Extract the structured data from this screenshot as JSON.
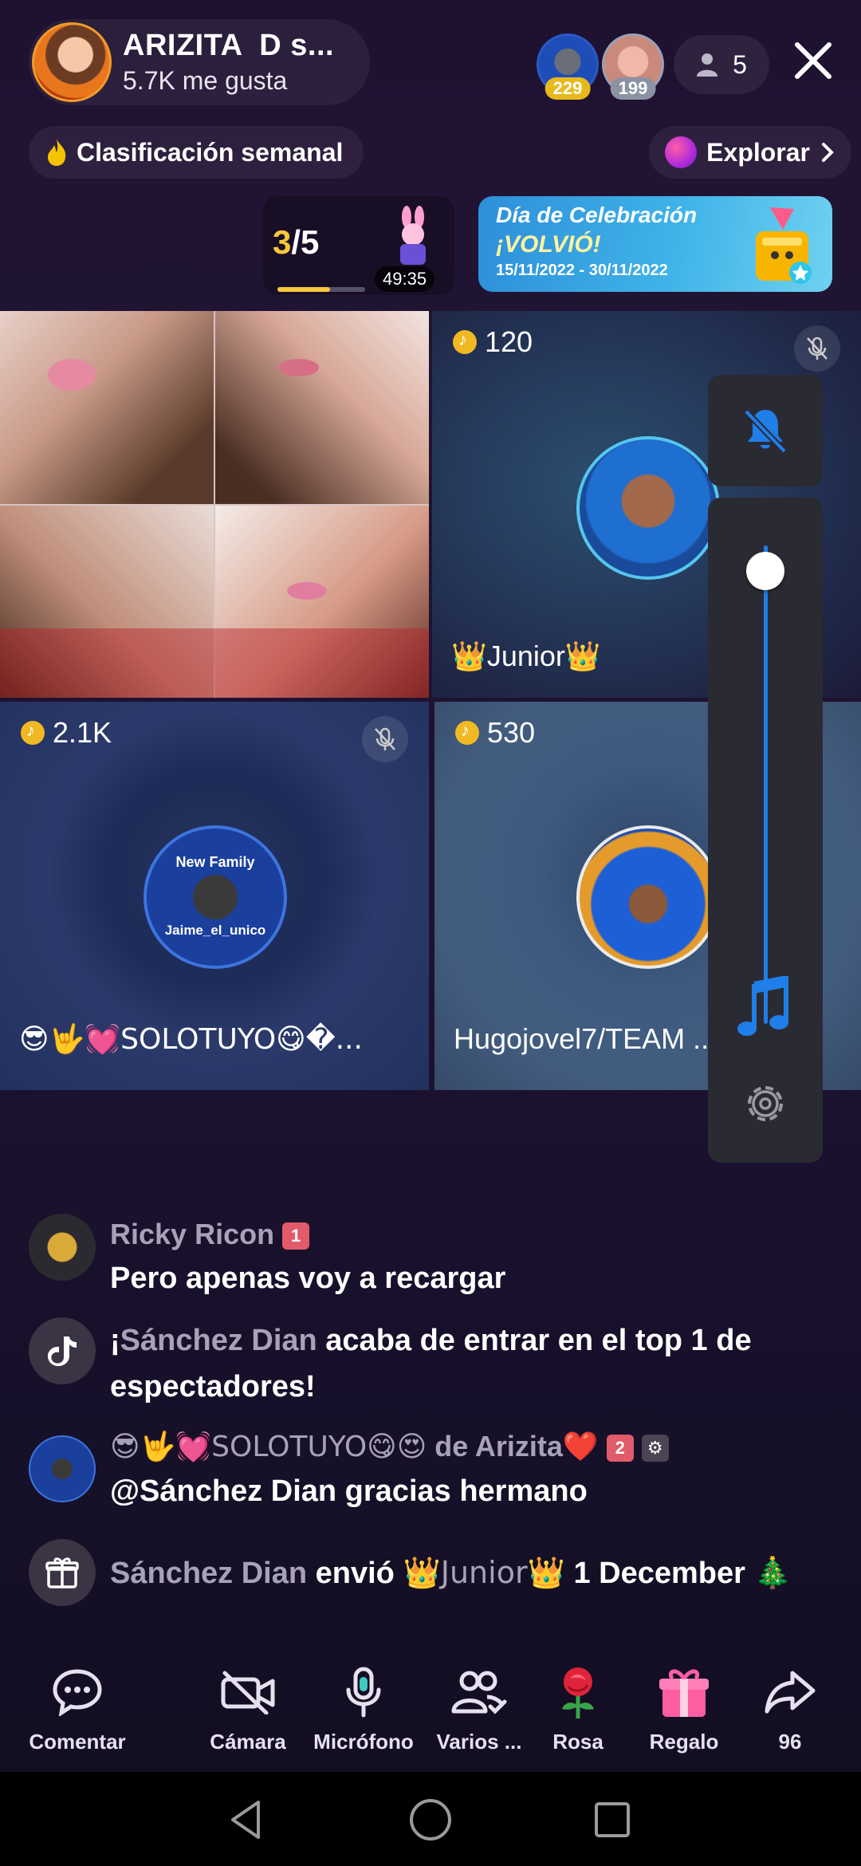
{
  "host": {
    "name": "ARIZITA  D s...",
    "likes": "5.7K me gusta"
  },
  "top_viewers": [
    {
      "badge": "229",
      "color": "#e7b91c"
    },
    {
      "badge": "199",
      "color": "#8b93a3"
    }
  ],
  "viewer_count": "5",
  "ranking_label": "Clasificación semanal",
  "explore_label": "Explorar",
  "goal": {
    "current": "3",
    "separator": "/",
    "total": "5",
    "progress": 0.6,
    "timer": "49:35"
  },
  "banner": {
    "title": "Día de Celebración",
    "subtitle": "¡VOLVIÓ!",
    "dates": "15/11/2022 - 30/11/2022"
  },
  "guests": [
    {
      "coins": "",
      "name": ""
    },
    {
      "coins": "120",
      "name": "👑Junior👑"
    },
    {
      "coins": "2.1K",
      "name": "😎🤟💓SOLOTUYO😋�...",
      "avatar_line1": "New Family",
      "avatar_line2": "Jaime_el_unico"
    },
    {
      "coins": "530",
      "name": "Hugojovel7/TEAM ..."
    }
  ],
  "chat": [
    {
      "user": "Ricky Ricon",
      "badge": "1",
      "message": "Pero apenas voy a recargar"
    },
    {
      "system_user": "Sánchez Dian",
      "system_prefix": "¡",
      "system_text": " acaba de entrar en el top 1 de espectadores!"
    },
    {
      "user": "😎🤟💓SOLOTUYO😋😍",
      "user_suffix": " de Arizita❤️",
      "badge": "2",
      "message": "@Sánchez Dian gracias hermano"
    },
    {
      "gift_user": "Sánchez Dian",
      "gift_verb": " envió ",
      "gift_target": "👑Junior👑",
      "gift_name": " 1 December"
    }
  ],
  "bottom_bar": [
    {
      "label": "Comentar",
      "icon": "comment-icon"
    },
    {
      "label": "Cámara",
      "icon": "camera-off-icon"
    },
    {
      "label": "Micrófono",
      "icon": "microphone-icon"
    },
    {
      "label": "Varios ...",
      "icon": "multi-guest-icon"
    },
    {
      "label": "Rosa",
      "icon": "rose-icon"
    },
    {
      "label": "Regalo",
      "icon": "gift-icon"
    },
    {
      "label": "96",
      "icon": "share-icon"
    }
  ],
  "colors": {
    "accent_blue": "#1f7ee8",
    "gold": "#f7c83a",
    "panel": "#2a2a32"
  }
}
